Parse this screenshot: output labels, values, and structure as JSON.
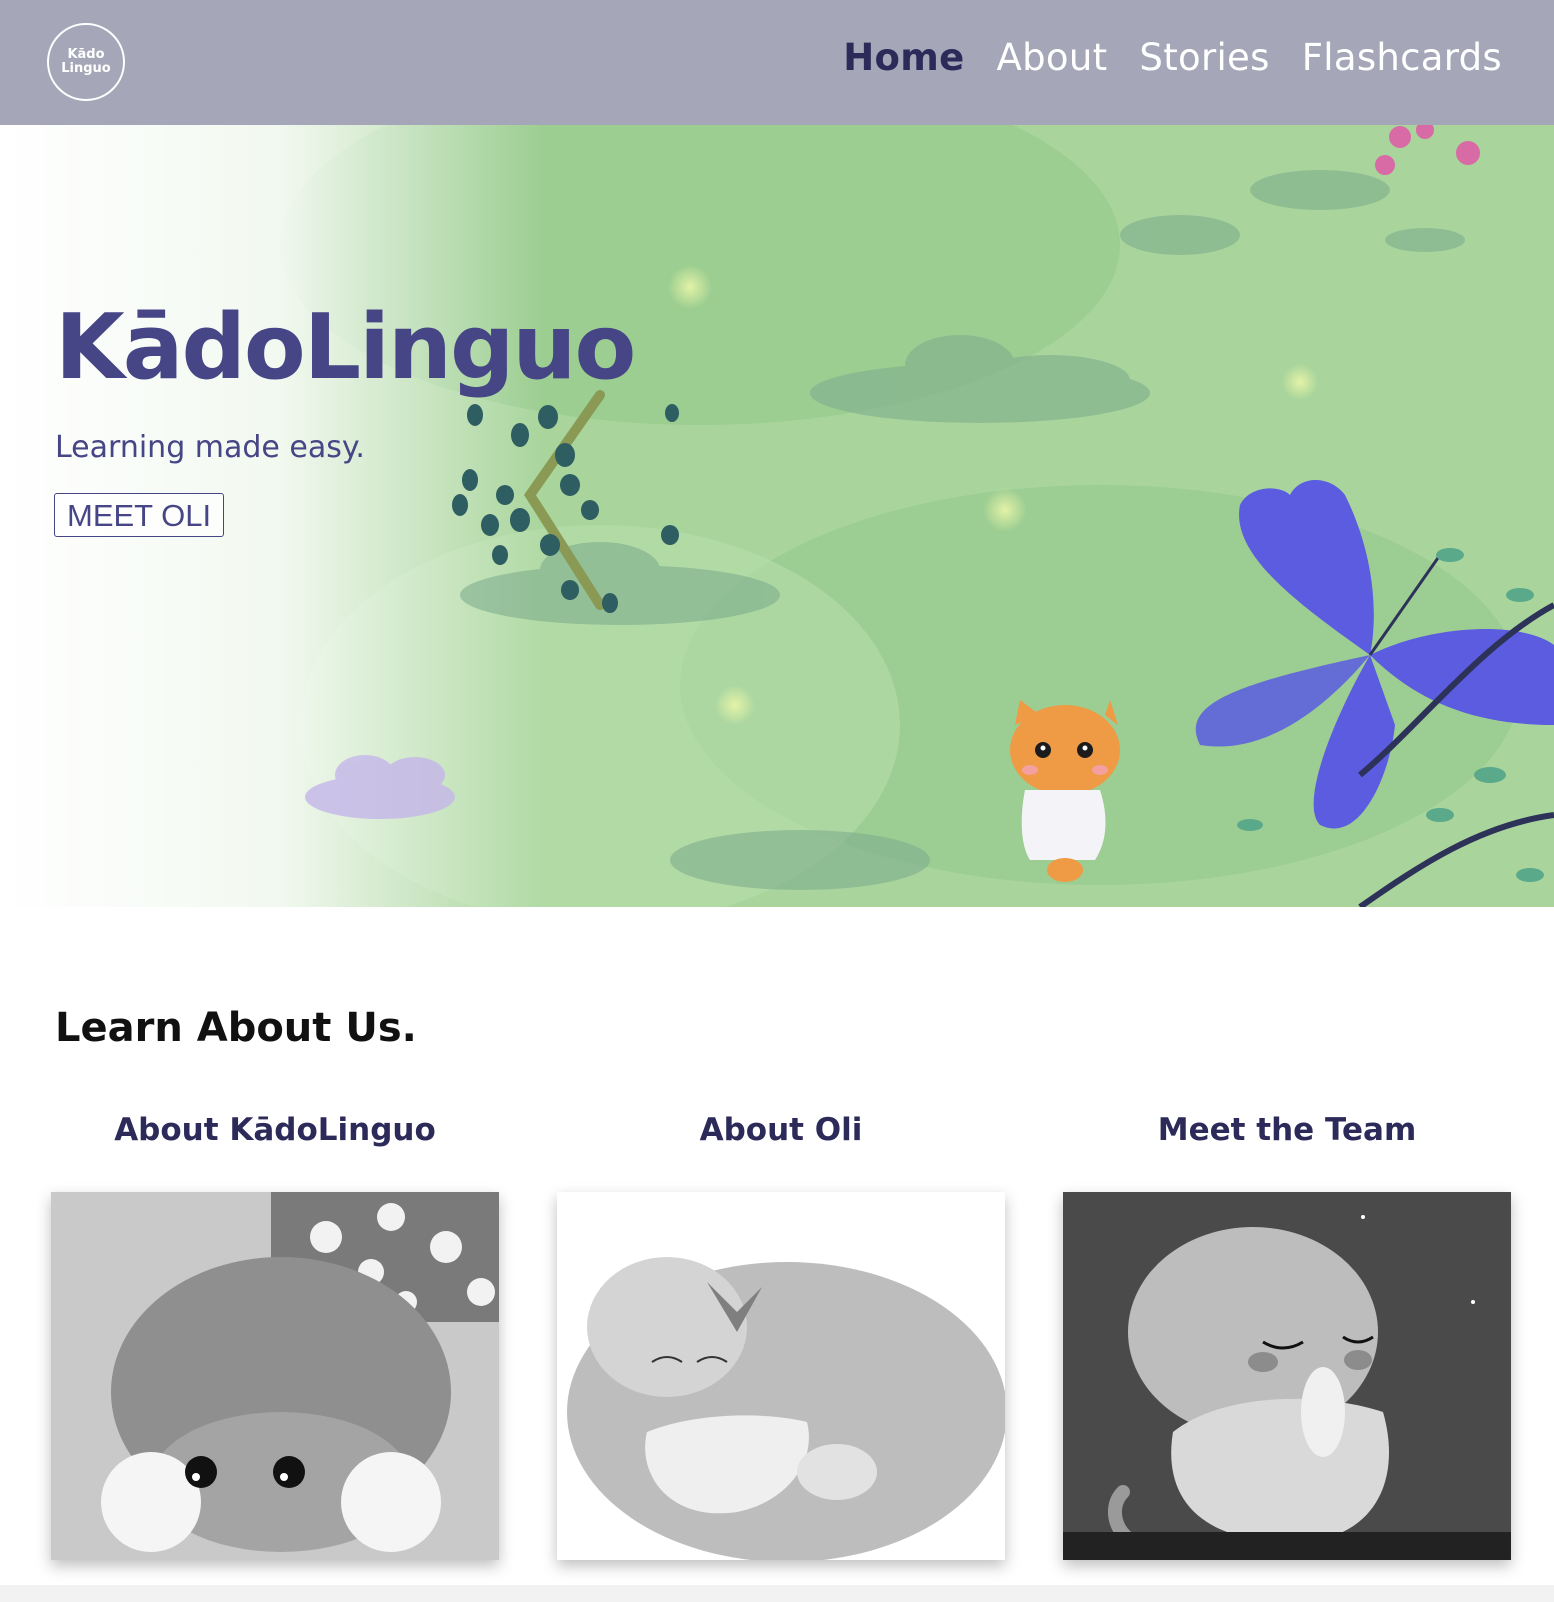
{
  "header": {
    "logo_line1": "Kādo",
    "logo_line2": "Linguo",
    "nav": [
      "Home",
      "About",
      "Stories",
      "Flashcards"
    ],
    "active": "Home"
  },
  "hero": {
    "title": "KādoLinguo",
    "subtitle": "Learning made easy.",
    "button": "MEET OLI"
  },
  "about": {
    "title": "Learn About Us.",
    "cards": [
      {
        "title": "About KādoLinguo",
        "image": "upside-down-cat-illustration"
      },
      {
        "title": "About Oli",
        "image": "sleeping-cat-butterfly-illustration"
      },
      {
        "title": "Meet the Team",
        "image": "night-cat-moon-illustration"
      }
    ]
  },
  "colors": {
    "header_bg": "#a5a7b9",
    "brand_purple": "#464585",
    "nav_active": "#2c2a59",
    "hero_green": "#a7d29a",
    "butterfly": "#5b5ce0"
  }
}
